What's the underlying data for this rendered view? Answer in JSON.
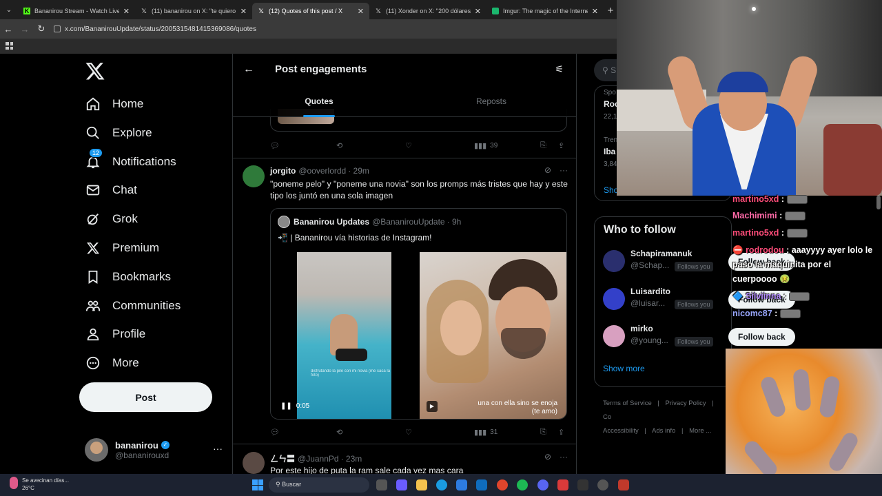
{
  "browser": {
    "tabs": [
      {
        "title": "Bananirou Stream - Watch Live",
        "icon": "kick-icon",
        "active": false
      },
      {
        "title": "(11) bananirou on X: \"te quiero",
        "icon": "x-icon",
        "active": false
      },
      {
        "title": "(12) Quotes of this post / X",
        "icon": "x-icon",
        "active": true
      },
      {
        "title": "(11) Xonder on X: \"200 dólares",
        "icon": "x-icon",
        "active": false
      },
      {
        "title": "Imgur: The magic of the Interne",
        "icon": "imgur-icon",
        "active": false
      }
    ],
    "url": "x.com/BananirouUpdate/status/2005315481415369086/quotes"
  },
  "nav": {
    "items": [
      {
        "label": "Home",
        "icon": "home-icon"
      },
      {
        "label": "Explore",
        "icon": "search-icon"
      },
      {
        "label": "Notifications",
        "icon": "bell-icon",
        "badge": "12"
      },
      {
        "label": "Chat",
        "icon": "mail-icon"
      },
      {
        "label": "Grok",
        "icon": "grok-icon"
      },
      {
        "label": "Premium",
        "icon": "x-logo-icon"
      },
      {
        "label": "Bookmarks",
        "icon": "bookmark-icon"
      },
      {
        "label": "Communities",
        "icon": "people-icon"
      },
      {
        "label": "Profile",
        "icon": "person-icon"
      },
      {
        "label": "More",
        "icon": "more-circle-icon"
      }
    ],
    "post_label": "Post",
    "account": {
      "name": "bananirou",
      "handle": "@bananirouxd",
      "more": "···"
    }
  },
  "header": {
    "title": "Post engagements",
    "tabs": [
      "Quotes",
      "Reposts"
    ]
  },
  "prev_tweet": {
    "views": "39"
  },
  "tweet1": {
    "name": "jorgito",
    "handle": "@ooverlordd",
    "time": "· 29m",
    "text": "\"poneme pelo\" y \"poneme una novia\" son los promps más tristes que hay y este tipo los juntó en una sola imagen",
    "quote": {
      "name": "Bananirou Updates",
      "handle": "@BananirouUpdate",
      "time": "· 9h",
      "text": "📲 | Bananirou vía historias de Instagram!",
      "video_time": "0:05",
      "caption_left": "disfrutando la pile con mi novia (me saca la foto)",
      "caption_right_1": "una con ella sino se enoja",
      "caption_right_2": "(te amo)"
    },
    "views": "31"
  },
  "tweet2": {
    "name": "ㄥㄣ〓",
    "handle": "@JuannPd",
    "time": "· 23m",
    "text": "Por este hijo de puta la ram sale cada vez mas cara"
  },
  "sidebar": {
    "search_placeholder": "S",
    "trends": [
      {
        "meta": "Spo",
        "title": "Roc",
        "count": "22,1"
      },
      {
        "meta": "Tren",
        "title": "Iba",
        "count": "3,84"
      }
    ],
    "trends_show": "Sho",
    "who_to_follow": "Who to follow",
    "follow_rows": [
      {
        "name": "Schapiramanuk",
        "handle": "@Schap...",
        "follows": "Follows you",
        "button": "Follow back",
        "color": "#2a2f6e"
      },
      {
        "name": "Luisardito",
        "handle": "@luisar...",
        "follows": "Follows you",
        "button": "Follow back",
        "color": "#3340c9"
      },
      {
        "name": "mirko",
        "handle": "@young...",
        "follows": "Follows you",
        "button": "Follow back",
        "color": "#d8a0c0"
      }
    ],
    "show_more": "Show more",
    "footer": [
      "Terms of Service",
      "|",
      "Privacy Policy",
      "|",
      "Co",
      "Accessibility",
      "|",
      "Ads info",
      "|",
      "More ..."
    ]
  },
  "chat": {
    "lines": [
      {
        "user": "martino5xd",
        "msg": "",
        "emote": true
      },
      {
        "user": "Machimimi",
        "msg": "",
        "emote": true
      },
      {
        "user": "martino5xd",
        "msg": "",
        "emote": true
      },
      {
        "user": "rodrodou",
        "msg": "aaayyyy ayer lolo le paso la maquinita por el cuerpoooo 🤢"
      },
      {
        "user": "Silviinna",
        "msg": "",
        "emote": true
      },
      {
        "user": "nicomc87",
        "msg": "",
        "emote": true
      }
    ]
  },
  "taskbar": {
    "weather_text": "Se avecinan días...",
    "temp": "26°C",
    "search": "Buscar"
  },
  "colors": {
    "accent": "#1d9bf0",
    "bg": "#000000",
    "border": "#2f3336",
    "muted": "#71767b"
  }
}
